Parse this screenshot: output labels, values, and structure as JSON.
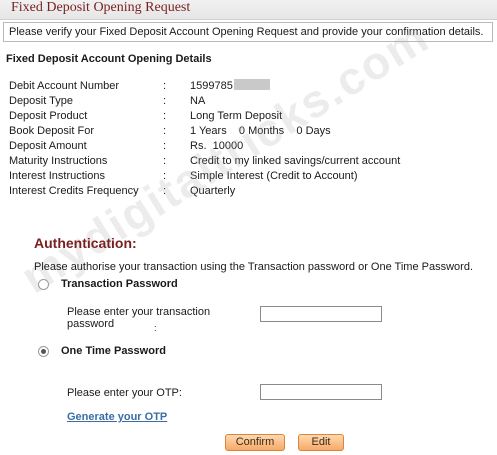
{
  "page": {
    "title": "Fixed Deposit Opening Request",
    "verify_message": "Please verify your Fixed Deposit Account Opening Request and provide your confirmation details."
  },
  "details": {
    "heading": "Fixed Deposit Account Opening Details",
    "rows": [
      {
        "label": "Debit Account Number",
        "colon": ":",
        "value": "1599785"
      },
      {
        "label": "Deposit Type",
        "colon": ":",
        "value": "NA"
      },
      {
        "label": "Deposit Product",
        "colon": ":",
        "value": "Long Term Deposit"
      },
      {
        "label": "Book Deposit For",
        "colon": ":",
        "value": "1 Years    0 Months    0 Days"
      },
      {
        "label": "Deposit Amount",
        "colon": ":",
        "value": "Rs.  10000"
      },
      {
        "label": "Maturity Instructions",
        "colon": ":",
        "value": "Credit to my linked savings/current account"
      },
      {
        "label": "Interest Instructions",
        "colon": ":",
        "value": "Simple Interest (Credit to Account)"
      },
      {
        "label": "Interest Credits Frequency",
        "colon": ":",
        "value": "Quarterly"
      }
    ]
  },
  "auth": {
    "title": "Authentication:",
    "description": "Please authorise your transaction using the Transaction password or One Time Password.",
    "transaction_password": {
      "label": "Transaction Password",
      "selected": false,
      "field_label_line1": "Please enter your transaction",
      "field_label_line2": "password",
      "field_colon": ":",
      "value": ""
    },
    "otp": {
      "label": "One Time Password",
      "selected": true,
      "field_label": "Please enter your OTP:",
      "value": ""
    },
    "generate_link": "Generate your OTP"
  },
  "buttons": {
    "confirm": "Confirm",
    "edit": "Edit"
  },
  "watermark": "mydigitaltricks.com"
}
